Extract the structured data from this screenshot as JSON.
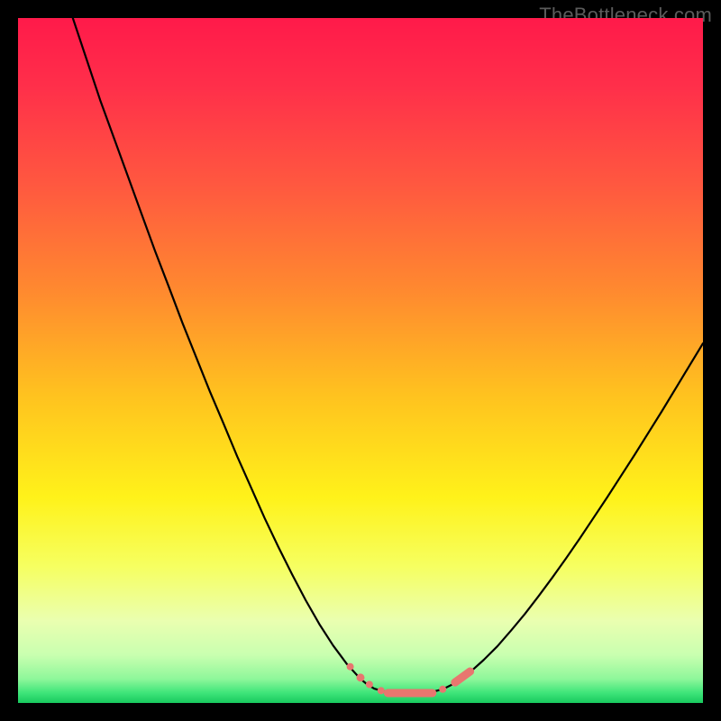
{
  "watermark": "TheBottleneck.com",
  "colors": {
    "frame": "#000000",
    "curve": "#000000",
    "marker": "#e8766f",
    "gradient_stops": [
      {
        "offset": 0.0,
        "color": "#ff1a4a"
      },
      {
        "offset": 0.1,
        "color": "#ff2f4a"
      },
      {
        "offset": 0.25,
        "color": "#ff5a3f"
      },
      {
        "offset": 0.4,
        "color": "#ff8a2f"
      },
      {
        "offset": 0.55,
        "color": "#ffc21f"
      },
      {
        "offset": 0.7,
        "color": "#fff21a"
      },
      {
        "offset": 0.8,
        "color": "#f6ff60"
      },
      {
        "offset": 0.88,
        "color": "#eaffb0"
      },
      {
        "offset": 0.93,
        "color": "#c9ffb0"
      },
      {
        "offset": 0.965,
        "color": "#8ef79a"
      },
      {
        "offset": 0.985,
        "color": "#3fe57a"
      },
      {
        "offset": 1.0,
        "color": "#18c95e"
      }
    ]
  },
  "chart_data": {
    "type": "line",
    "title": "",
    "xlabel": "",
    "ylabel": "",
    "x_range": [
      0,
      100
    ],
    "y_range": [
      0,
      100
    ],
    "series": [
      {
        "name": "left-branch",
        "x": [
          8,
          10,
          12,
          14,
          16,
          18,
          20,
          22,
          24,
          26,
          28,
          30,
          32,
          34,
          36,
          38,
          40,
          42,
          44,
          46,
          48,
          50,
          51,
          52
        ],
        "y": [
          100,
          94,
          88,
          82.5,
          77,
          71.5,
          66,
          60.8,
          55.5,
          50.5,
          45.5,
          40.8,
          36,
          31.5,
          27,
          22.8,
          18.8,
          15,
          11.5,
          8.4,
          5.7,
          3.5,
          2.7,
          2.1
        ]
      },
      {
        "name": "valley-floor",
        "x": [
          52,
          54,
          56,
          58,
          60,
          62
        ],
        "y": [
          2.1,
          1.5,
          1.3,
          1.3,
          1.5,
          2.0
        ]
      },
      {
        "name": "right-branch",
        "x": [
          62,
          64,
          66,
          68,
          70,
          72,
          74,
          76,
          78,
          80,
          82,
          84,
          86,
          88,
          90,
          92,
          94,
          96,
          98,
          100
        ],
        "y": [
          2.0,
          3.0,
          4.5,
          6.3,
          8.3,
          10.6,
          13.0,
          15.6,
          18.3,
          21.1,
          24.0,
          27.0,
          30.0,
          33.1,
          36.2,
          39.4,
          42.6,
          45.9,
          49.2,
          52.5
        ]
      }
    ],
    "markers": [
      {
        "x": 48.5,
        "y": 5.3,
        "r": 4.0,
        "kind": "dot"
      },
      {
        "x": 50.0,
        "y": 3.7,
        "r": 4.5,
        "kind": "dot"
      },
      {
        "x": 51.3,
        "y": 2.7,
        "r": 4.0,
        "kind": "dot"
      },
      {
        "x": 53.0,
        "y": 1.8,
        "r": 4.0,
        "kind": "dot"
      },
      {
        "x": 54.0,
        "y": 1.45,
        "x2": 60.5,
        "y2": 1.45,
        "r": 4.5,
        "kind": "segment"
      },
      {
        "x": 62.0,
        "y": 2.0,
        "r": 4.0,
        "kind": "dot"
      },
      {
        "x": 63.8,
        "y": 3.0,
        "x2": 66.0,
        "y2": 4.6,
        "r": 4.5,
        "kind": "segment"
      }
    ]
  }
}
